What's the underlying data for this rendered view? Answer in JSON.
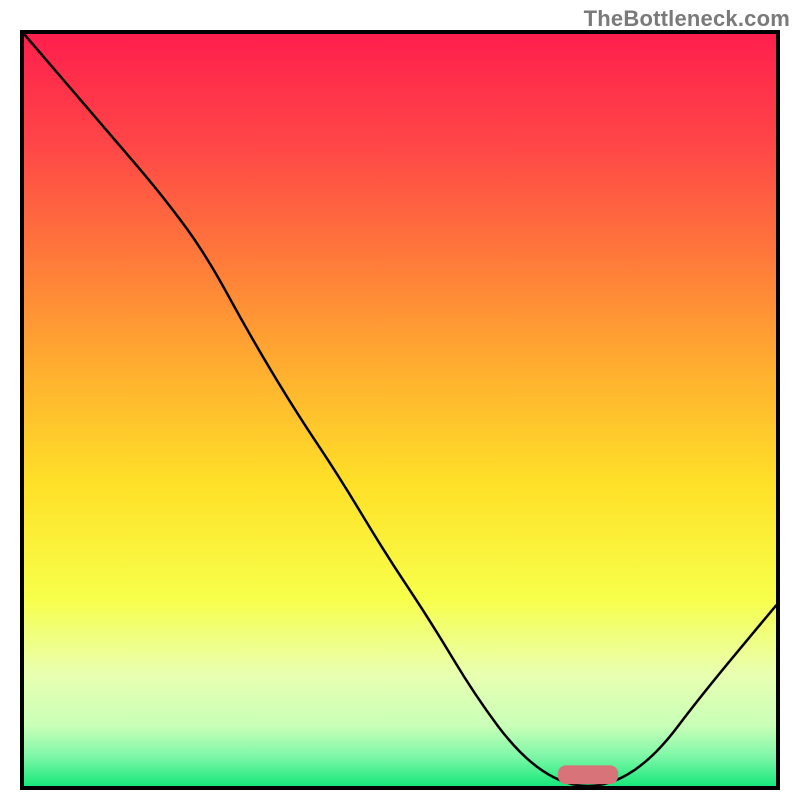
{
  "watermark": {
    "text": "TheBottleneck.com"
  },
  "chart_data": {
    "type": "line",
    "title": "",
    "xlabel": "",
    "ylabel": "",
    "xlim": [
      0,
      100
    ],
    "ylim": [
      0,
      100
    ],
    "grid": false,
    "legend": false,
    "curve": {
      "x": [
        0,
        6,
        12,
        18,
        24,
        30,
        36,
        42,
        48,
        54,
        60,
        66,
        72,
        78,
        84,
        90,
        100
      ],
      "y": [
        100,
        93,
        86,
        79,
        71,
        60,
        50,
        41,
        31,
        22,
        12,
        4,
        0,
        0,
        4,
        12,
        24
      ]
    },
    "marker": {
      "x": 75,
      "y": 1.5,
      "width": 8,
      "height": 2.5,
      "color": "#d9737a"
    },
    "gradient_stops": [
      {
        "offset": 0,
        "color": "#ff1f4d"
      },
      {
        "offset": 15,
        "color": "#ff4747"
      },
      {
        "offset": 30,
        "color": "#ff7a3a"
      },
      {
        "offset": 45,
        "color": "#ffb02f"
      },
      {
        "offset": 60,
        "color": "#ffe128"
      },
      {
        "offset": 75,
        "color": "#f7ff4a"
      },
      {
        "offset": 85,
        "color": "#e9ffb0"
      },
      {
        "offset": 92,
        "color": "#c9ffb8"
      },
      {
        "offset": 96,
        "color": "#7ff7a8"
      },
      {
        "offset": 100,
        "color": "#17e87a"
      }
    ],
    "frame_color": "#000000",
    "curve_color": "#000000",
    "curve_width": 2.5
  }
}
